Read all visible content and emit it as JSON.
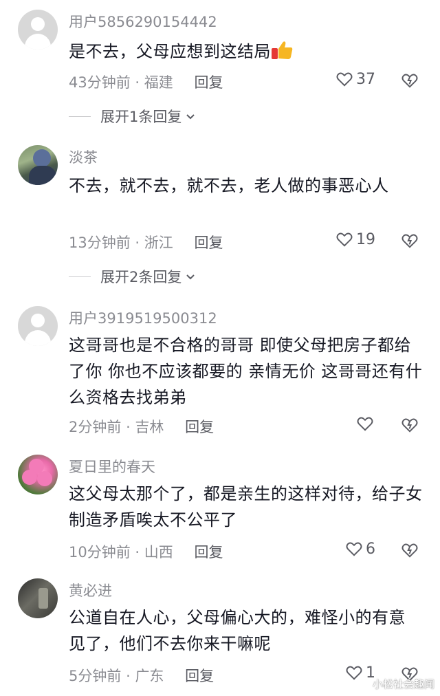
{
  "comments": [
    {
      "username": "用户5856290154442",
      "text": "是不去，父母应想到这结局",
      "emoji": "thumbs-up-emoji",
      "time": "43分钟前",
      "location": "福建",
      "reply_label": "回复",
      "likes": "37",
      "expand_label": "展开1条回复"
    },
    {
      "username": "淡茶",
      "text": "不去，就不去，就不去，老人做的事恶心人",
      "time": "13分钟前",
      "location": "浙江",
      "reply_label": "回复",
      "likes": "19",
      "expand_label": "展开2条回复"
    },
    {
      "username": "用户3919519500312",
      "text": "这哥哥也是不合格的哥哥  即使父母把房子都给了你  你也不应该都要的  亲情无价  这哥哥还有什么资格去找弟弟",
      "time": "2分钟前",
      "location": "吉林",
      "reply_label": "回复",
      "likes": ""
    },
    {
      "username": "夏日里的春天",
      "text": "这父母太那个了，都是亲生的这样对待，给子女制造矛盾唉太不公平了",
      "time": "10分钟前",
      "location": "山西",
      "reply_label": "回复",
      "likes": "6"
    },
    {
      "username": "黄必进",
      "text": "公道自在人心，父母偏心大的，难怪小的有意见了，他们不去你来干嘛呢",
      "time": "5分钟前",
      "location": "广东",
      "reply_label": "回复",
      "likes": "1"
    }
  ],
  "separator": "·",
  "watermark": "小松社会趣闻",
  "colors": {
    "text": "#161823",
    "meta": "#8a8b91",
    "action": "#5a5b62"
  }
}
